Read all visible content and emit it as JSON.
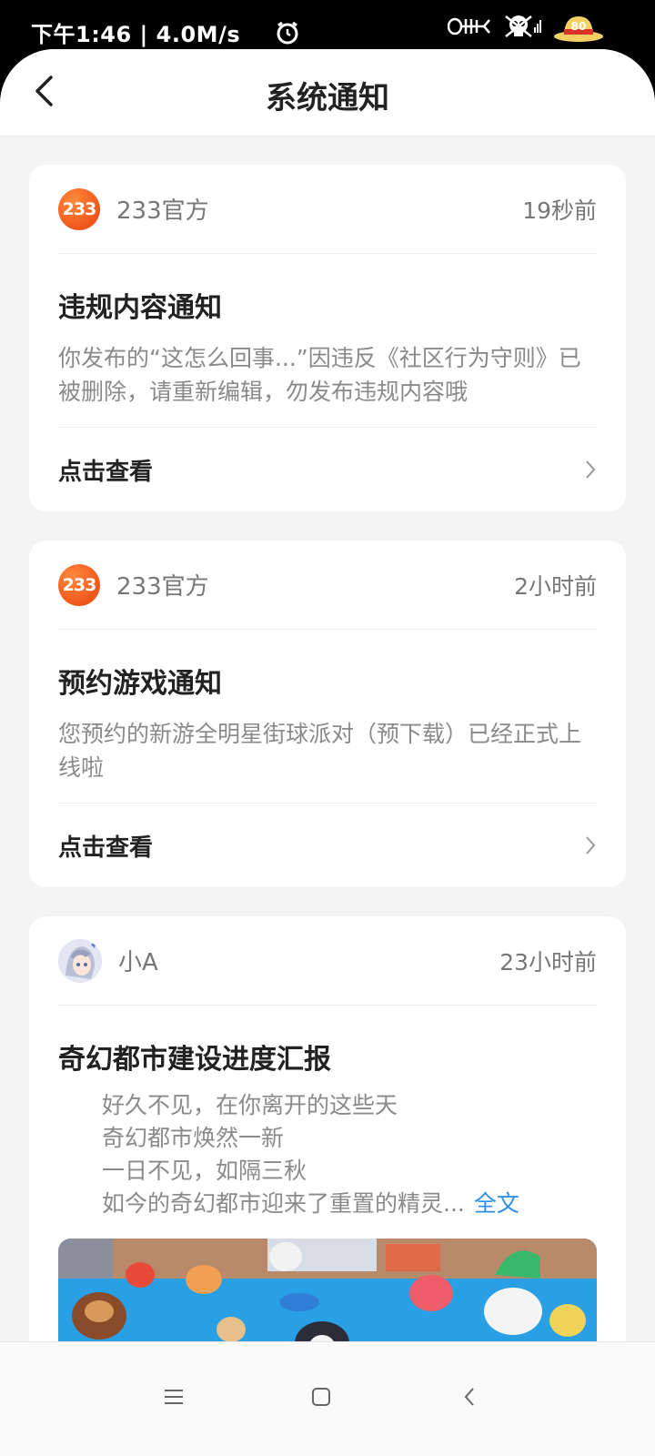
{
  "status": {
    "time_speed": "下午1:46 | 4.0M/s",
    "battery": "80",
    "icons": [
      "alarm-icon",
      "fishbone-icon",
      "skull-icon",
      "straw-hat-battery-icon"
    ]
  },
  "header": {
    "title": "系统通知"
  },
  "notifications": [
    {
      "sender": "233官方",
      "avatar_text": "233",
      "time": "19秒前",
      "title": "违规内容通知",
      "body": "你发布的“这怎么回事...”因违反《社区行为守则》已被删除，请重新编辑，勿发布违规内容哦",
      "action": "点击查看"
    },
    {
      "sender": "233官方",
      "avatar_text": "233",
      "time": "2小时前",
      "title": "预约游戏通知",
      "body": "您预约的新游全明星街球派对（预下载）已经正式上线啦",
      "action": "点击查看"
    },
    {
      "sender": "小A",
      "time": "23小时前",
      "title": "奇幻都市建设进度汇报",
      "lines": [
        "好久不见，在你离开的这些天",
        "奇幻都市焕然一新",
        "一日不见，如隔三秋",
        "如今的奇幻都市迎来了重置的精灵..."
      ],
      "full_text": "全文"
    }
  ],
  "colors": {
    "accent": "#2f8fe8",
    "avatar_orange": "#f0561a",
    "background": "#f4f4f4"
  }
}
